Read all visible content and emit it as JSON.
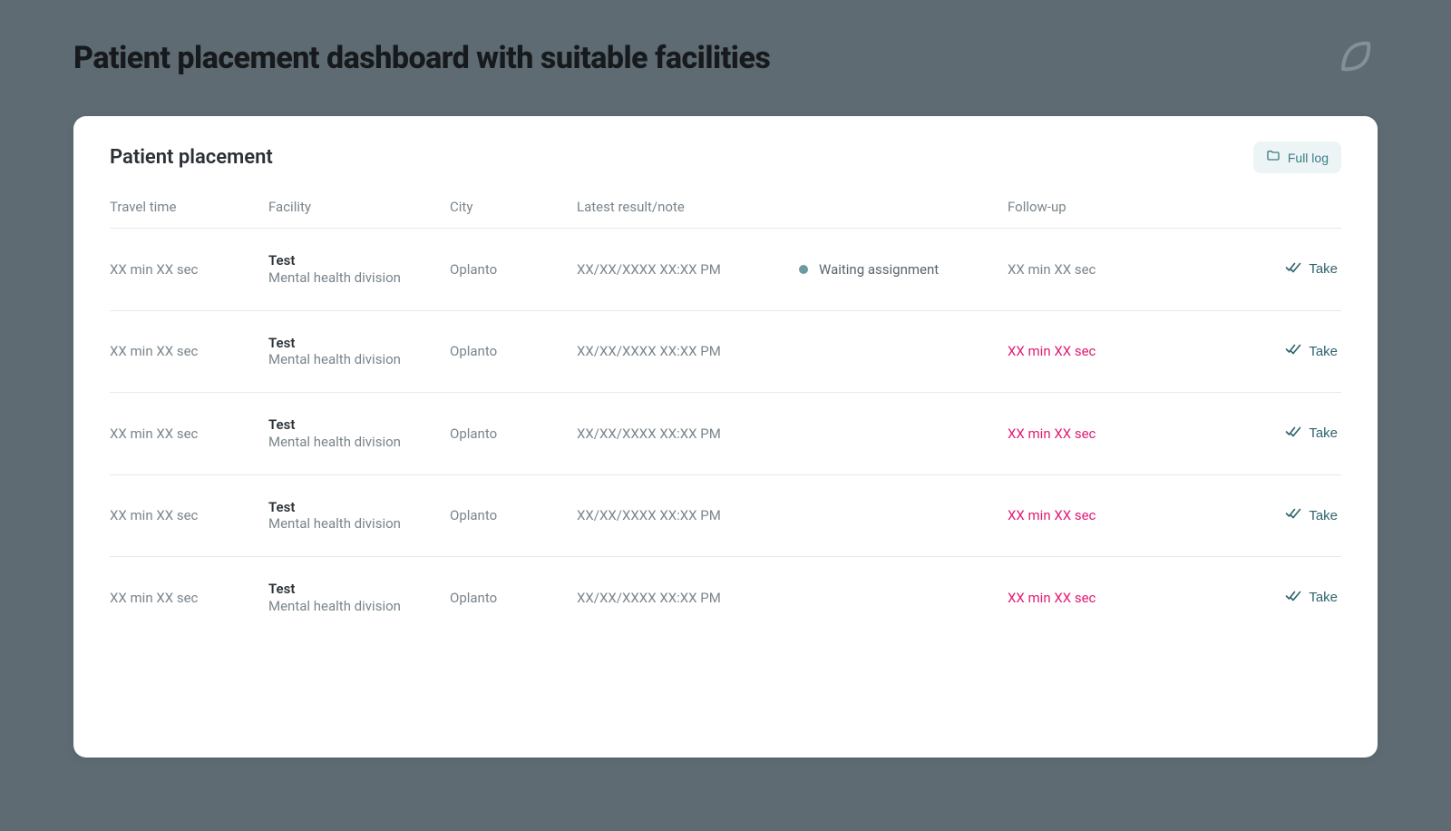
{
  "page": {
    "title": "Patient placement dashboard with suitable facilities"
  },
  "card": {
    "title": "Patient placement",
    "full_log_label": "Full log"
  },
  "columns": {
    "travel_time": "Travel time",
    "facility": "Facility",
    "city": "City",
    "latest": "Latest result/note",
    "followup": "Follow-up"
  },
  "take_label": "Take",
  "rows": [
    {
      "travel_time": "XX min XX sec",
      "facility_name": "Test",
      "facility_sub": "Mental health division",
      "city": "Oplanto",
      "latest": "XX/XX/XXXX XX:XX PM",
      "status": "Waiting assignment",
      "followup": "XX min XX sec",
      "followup_overdue": false
    },
    {
      "travel_time": "XX min XX sec",
      "facility_name": "Test",
      "facility_sub": "Mental health division",
      "city": "Oplanto",
      "latest": "XX/XX/XXXX XX:XX PM",
      "status": "",
      "followup": "XX min XX sec",
      "followup_overdue": true
    },
    {
      "travel_time": "XX min XX sec",
      "facility_name": "Test",
      "facility_sub": "Mental health division",
      "city": "Oplanto",
      "latest": "XX/XX/XXXX XX:XX PM",
      "status": "",
      "followup": "XX min XX sec",
      "followup_overdue": true
    },
    {
      "travel_time": "XX min XX sec",
      "facility_name": "Test",
      "facility_sub": "Mental health division",
      "city": "Oplanto",
      "latest": "XX/XX/XXXX XX:XX PM",
      "status": "",
      "followup": "XX min XX sec",
      "followup_overdue": true
    },
    {
      "travel_time": "XX min XX sec",
      "facility_name": "Test",
      "facility_sub": "Mental health division",
      "city": "Oplanto",
      "latest": "XX/XX/XXXX XX:XX PM",
      "status": "",
      "followup": "XX min XX sec",
      "followup_overdue": true
    }
  ]
}
